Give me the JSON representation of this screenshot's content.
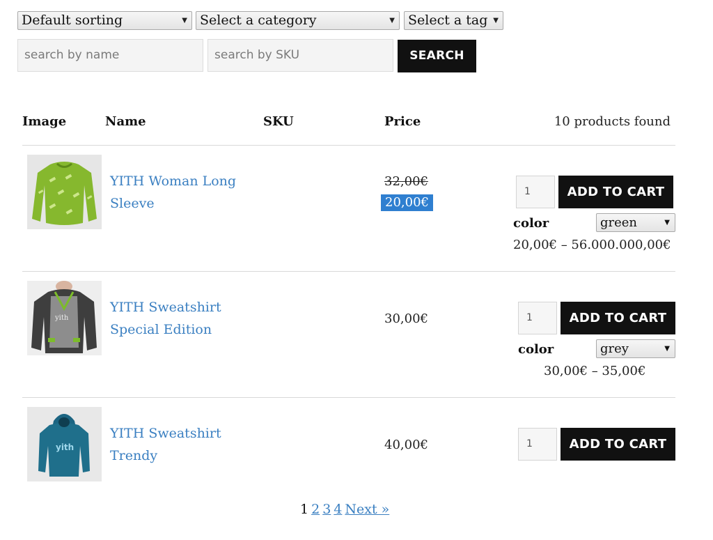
{
  "filters": {
    "sorting": "Default sorting",
    "category": "Select a category",
    "tag": "Select a tag",
    "search_name_placeholder": "search by name",
    "search_sku_placeholder": "search by SKU",
    "search_button": "SEARCH"
  },
  "table": {
    "headers": {
      "image": "Image",
      "name": "Name",
      "sku": "SKU",
      "price": "Price"
    },
    "found": "10 products found"
  },
  "products": [
    {
      "name_line1": "YITH Woman Long",
      "name_line2": "Sleeve",
      "price_old": "32,00€",
      "price": "20,00€",
      "qty": "1",
      "add_to_cart": "ADD TO CART",
      "attr_label": "color",
      "attr_value": "green",
      "range": "20,00€ – 56.000.000,00€",
      "thumb_color": "#86b82e"
    },
    {
      "name_line1": "YITH Sweatshirt",
      "name_line2": "Special Edition",
      "price": "30,00€",
      "qty": "1",
      "add_to_cart": "ADD TO CART",
      "attr_label": "color",
      "attr_value": "grey",
      "range": "30,00€ – 35,00€",
      "thumb_color": "#4a4a4a"
    },
    {
      "name_line1": "YITH Sweatshirt",
      "name_line2": "Trendy",
      "price": "40,00€",
      "qty": "1",
      "add_to_cart": "ADD TO CART",
      "thumb_color": "#1f6f8b"
    }
  ],
  "pagination": {
    "current": "1",
    "pages": [
      "2",
      "3",
      "4"
    ],
    "next": "Next »"
  },
  "colors": {
    "link": "#3a7fc1",
    "button": "#111111",
    "highlight": "#2f7fd0"
  }
}
